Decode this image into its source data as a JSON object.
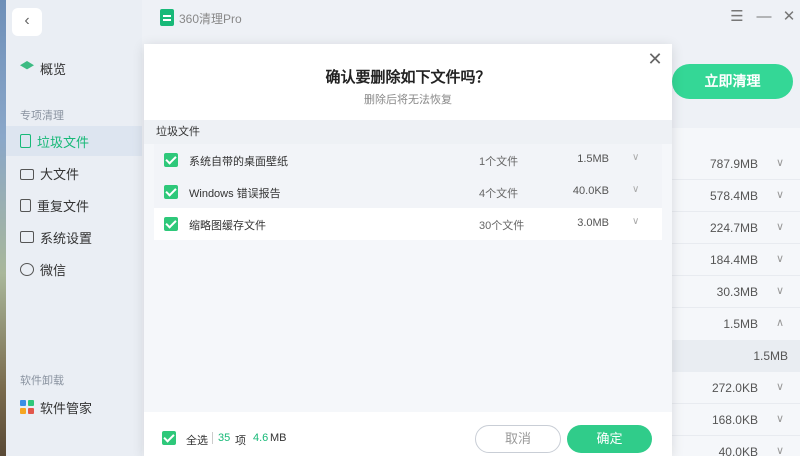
{
  "app": {
    "title": "360清理Pro"
  },
  "window_controls": {
    "menu": "☰",
    "minimize": "—",
    "close": "✕"
  },
  "sidebar": {
    "back": "‹",
    "overview": "概览",
    "section_cleanup": "专项清理",
    "items": [
      {
        "label": "垃圾文件",
        "icon": "document-icon",
        "active": true
      },
      {
        "label": "大文件",
        "icon": "folder-icon",
        "active": false
      },
      {
        "label": "重复文件",
        "icon": "duplicate-file-icon",
        "active": false
      },
      {
        "label": "系统设置",
        "icon": "settings-panel-icon",
        "active": false
      },
      {
        "label": "微信",
        "icon": "wechat-icon",
        "active": false
      }
    ],
    "section_uninstall": "软件卸载",
    "software_manager": "软件管家"
  },
  "background": {
    "clean_now": "立即清理",
    "rows": [
      {
        "size": "787.9MB",
        "chevron": "∨"
      },
      {
        "size": "578.4MB",
        "chevron": "∨"
      },
      {
        "size": "224.7MB",
        "chevron": "∨"
      },
      {
        "size": "184.4MB",
        "chevron": "∨"
      },
      {
        "size": "30.3MB",
        "chevron": "∨"
      },
      {
        "size": "1.5MB",
        "chevron": "∧"
      },
      {
        "size": "1.5MB",
        "chevron": ""
      },
      {
        "size": "272.0KB",
        "chevron": "∨"
      },
      {
        "size": "168.0KB",
        "chevron": "∨"
      },
      {
        "size": "40.0KB",
        "chevron": "∨"
      }
    ]
  },
  "dialog": {
    "close": "✕",
    "title": "确认要删除如下文件吗？",
    "subtitle": "删除后将无法恢复",
    "group_label": "垃圾文件",
    "files": [
      {
        "name": "系统自带的桌面壁纸",
        "count": "1个文件",
        "size": "1.5MB",
        "checked": true
      },
      {
        "name": "Windows 错误报告",
        "count": "4个文件",
        "size": "40.0KB",
        "checked": true
      },
      {
        "name": "缩略图缓存文件",
        "count": "30个文件",
        "size": "3.0MB",
        "checked": true
      }
    ],
    "footer": {
      "select_all": "全选",
      "count": "35",
      "count_unit": "项",
      "size": "4.6",
      "size_unit": "MB",
      "cancel": "取消",
      "confirm": "确定"
    }
  },
  "colors": {
    "accent": "#17b978",
    "button_green": "#30cc8a",
    "checkbox": "#2ec87a"
  }
}
